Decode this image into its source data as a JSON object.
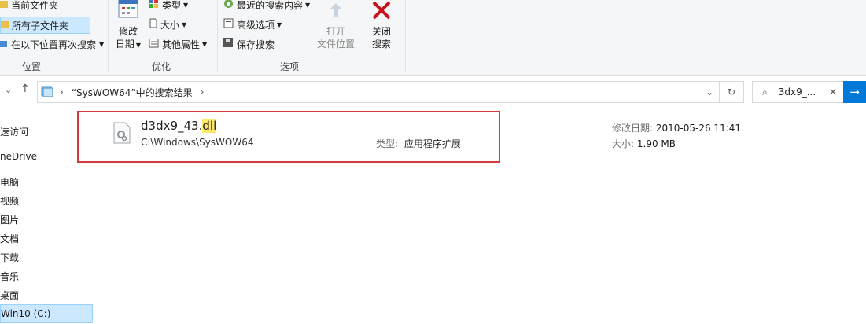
{
  "ribbon": {
    "location": {
      "current_folder": "当前文件夹",
      "all_subfolders": "所有子文件夹",
      "search_again_in": "在以下位置再次搜索",
      "group_label": "位置"
    },
    "refine": {
      "modified_line1": "修改",
      "modified_line2": "日期",
      "type": "类型",
      "size": "大小",
      "other_props": "其他属性",
      "group_label": "优化"
    },
    "options": {
      "recent_searches": "最近的搜索内容",
      "advanced_options": "高级选项",
      "save_search": "保存搜索",
      "open_line1": "打开",
      "open_line2": "文件位置",
      "close_line1": "关闭",
      "close_line2": "搜索",
      "group_label": "选项"
    }
  },
  "address": {
    "path_label": "“SysWOW64”中的搜索结果",
    "search_text": "3dx9_..."
  },
  "nav": {
    "items": [
      "速访问",
      "neDrive",
      "电脑",
      "视频",
      "图片",
      "文档",
      "下载",
      "音乐",
      "桌面",
      "Win10 (C:)"
    ]
  },
  "result": {
    "name_prefix": "d3dx9_43.",
    "name_highlight": "dll",
    "path": "C:\\Windows\\SysWOW64",
    "type_label": "类型:",
    "type_value": "应用程序扩展",
    "modified_label": "修改日期:",
    "modified_value": "2010-05-26 11:41",
    "size_label": "大小:",
    "size_value": "1.90 MB"
  },
  "colors": {
    "accent": "#0078d7",
    "highlight_border": "#d9393d",
    "match_highlight": "#ffe86a",
    "selected_bg": "#cce8ff"
  }
}
